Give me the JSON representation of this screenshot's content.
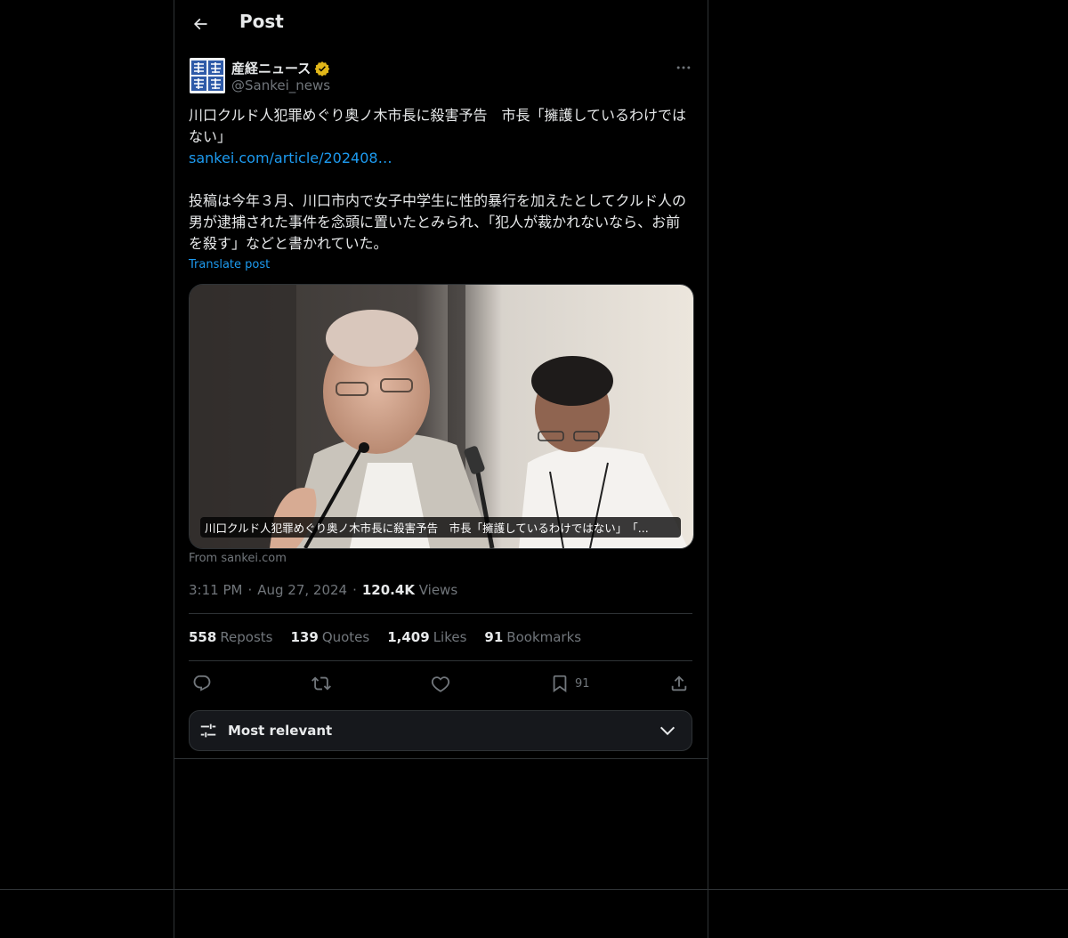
{
  "header": {
    "title": "Post"
  },
  "author": {
    "display_name": "産経ニュース",
    "handle": "@Sankei_news",
    "verified_color": "#e2b719"
  },
  "post": {
    "headline": "川口クルド人犯罪めぐり奥ノ木市長に殺害予告　市長「擁護しているわけではない」",
    "link": "sankei.com/article/202408…",
    "body": "投稿は今年３月、川口市内で女子中学生に性的暴行を加えたとしてクルド人の男が逮捕された事件を念頭に置いたとみられ、「犯人が裁かれないなら、お前を殺す」などと書かれていた。",
    "translate_label": "Translate post"
  },
  "card": {
    "caption": "川口クルド人犯罪めぐり奥ノ木市長に殺害予告　市長「擁護しているわけではない」　「...",
    "source": "From sankei.com"
  },
  "meta": {
    "time": "3:11 PM",
    "date": "Aug 27, 2024",
    "views_count": "120.4K",
    "views_label": "Views"
  },
  "stats": {
    "reposts_count": "558",
    "reposts_label": "Reposts",
    "quotes_count": "139",
    "quotes_label": "Quotes",
    "likes_count": "1,409",
    "likes_label": "Likes",
    "bookmarks_count": "91",
    "bookmarks_label": "Bookmarks"
  },
  "actions": {
    "bookmark_count": "91"
  },
  "sort": {
    "label": "Most relevant"
  },
  "colors": {
    "accent": "#1d9bf0",
    "border": "#2f3336",
    "muted": "#71767b"
  }
}
